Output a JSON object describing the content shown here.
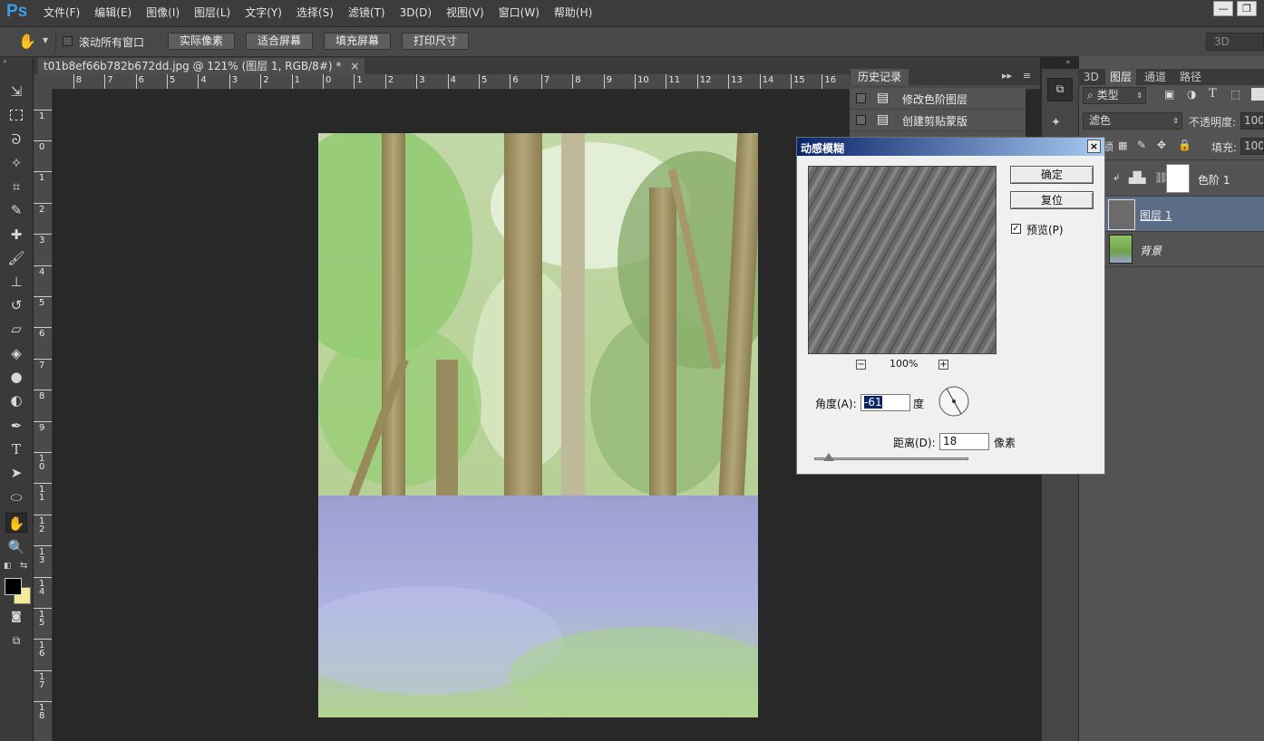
{
  "app": {
    "logo": "Ps"
  },
  "menu": [
    "文件(F)",
    "编辑(E)",
    "图像(I)",
    "图层(L)",
    "文字(Y)",
    "选择(S)",
    "滤镜(T)",
    "3D(D)",
    "视图(V)",
    "窗口(W)",
    "帮助(H)"
  ],
  "window_controls": {
    "minimize": "—",
    "restore": "❐"
  },
  "options_bar": {
    "scroll_all_label": "滚动所有窗口",
    "buttons": [
      "实际像素",
      "适合屏幕",
      "填充屏幕",
      "打印尺寸"
    ],
    "workspace": "3D"
  },
  "document": {
    "tab_title": "t01b8ef66b782b672dd.jpg @ 121% (图层 1, RGB/8#) *",
    "close": "×"
  },
  "ruler_top": [
    "8",
    "7",
    "6",
    "5",
    "4",
    "3",
    "2",
    "1",
    "0",
    "1",
    "2",
    "3",
    "4",
    "5",
    "6",
    "7",
    "8",
    "9",
    "10",
    "11",
    "12",
    "13",
    "14",
    "15",
    "16"
  ],
  "ruler_left": [
    "1",
    "0",
    "1",
    "2",
    "3",
    "4",
    "5",
    "6",
    "7",
    "8",
    "9",
    "1\n0",
    "1\n1",
    "1\n2",
    "1\n3",
    "1\n4",
    "1\n5",
    "1\n6",
    "1\n7",
    "1\n8"
  ],
  "history": {
    "tab": "历史记录",
    "items": [
      "修改色阶图层",
      "创建剪贴蒙版"
    ]
  },
  "layers_panel": {
    "tabs": [
      "3D",
      "图层",
      "通道",
      "路径"
    ],
    "filter_kind": "类型",
    "blend_mode": "滤色",
    "opacity_label": "不透明度:",
    "opacity_value": "100",
    "lock_label": "锁",
    "fill_label": "填充:",
    "fill_value": "100",
    "layers": [
      {
        "name": "色阶 1",
        "type": "adjustment"
      },
      {
        "name": "图层 1",
        "type": "pixel",
        "selected": true
      },
      {
        "name": "背景",
        "type": "background"
      }
    ]
  },
  "dialog": {
    "title": "动感模糊",
    "ok": "确定",
    "reset": "复位",
    "preview_label": "预览(P)",
    "preview_checked": true,
    "zoom_out": "−",
    "zoom": "100%",
    "zoom_in": "+",
    "angle_label": "角度(A):",
    "angle_value": "-61",
    "angle_unit": "度",
    "distance_label": "距离(D):",
    "distance_value": "18",
    "distance_unit": "像素"
  },
  "colors": {
    "accent": "#3c9be8",
    "dialog_title_start": "#0a246a",
    "dialog_title_end": "#a6caf0"
  }
}
